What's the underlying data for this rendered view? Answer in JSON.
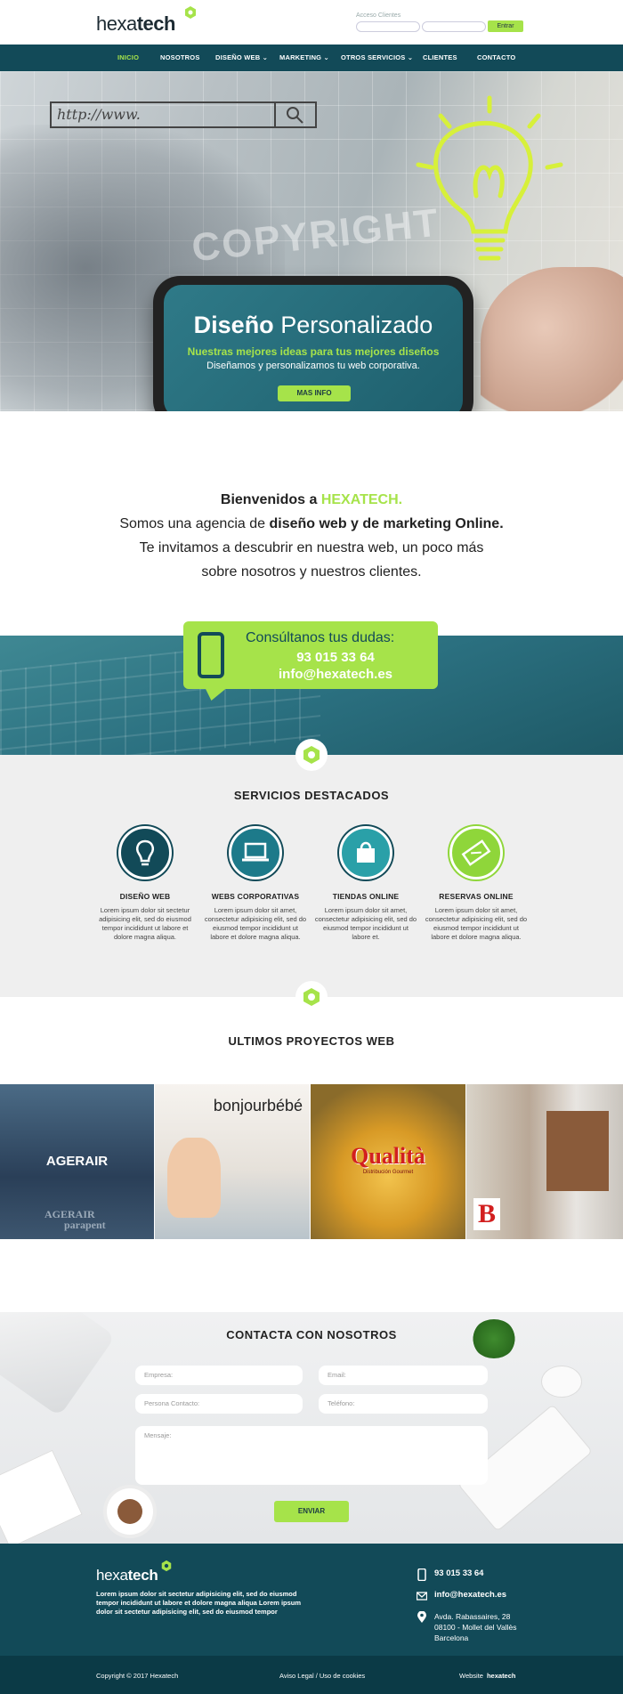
{
  "header": {
    "logo_light": "hexa",
    "logo_bold": "tech",
    "login_label": "Acceso Clientes",
    "login_button": "Entrar"
  },
  "nav": {
    "items": [
      "INICIO",
      "NOSOTROS",
      "DISEÑO WEB",
      "MARKETING",
      "OTROS SERVICIOS",
      "CLIENTES",
      "CONTACTO"
    ],
    "active": "INICIO"
  },
  "hero": {
    "url_text": "http://www.",
    "bg_text": "COPYRIGHT",
    "title_bold": "Diseño",
    "title_light": "Personalizado",
    "subtitle": "Nuestras mejores ideas para tus mejores diseños",
    "description": "Diseñamos y personalizamos tu web corporativa.",
    "button": "MAS INFO"
  },
  "welcome": {
    "line1_pre": "Bienvenidos a ",
    "line1_accent": "HEXATECH.",
    "line2_pre": "Somos una agencia de ",
    "line2_bold": "diseño web y de marketing Online.",
    "line3": "Te invitamos a descubrir en nuestra web, un poco más",
    "line4": "sobre nosotros y nuestros clientes."
  },
  "banner": {
    "title": "Consúltanos tus dudas:",
    "phone": "93 015 33 64",
    "email": "info@hexatech.es"
  },
  "services": {
    "title": "SERVICIOS DESTACADOS",
    "items": [
      {
        "name": "DISEÑO WEB",
        "icon": "lightbulb-icon",
        "color": "#124a58",
        "desc": "Lorem ipsum dolor sit sectetur adipisicing elit, sed do eiusmod tempor incididunt ut labore et dolore magna aliqua."
      },
      {
        "name": "WEBS CORPORATIVAS",
        "icon": "laptop-icon",
        "color": "#1d7a8a",
        "desc": "Lorem ipsum dolor sit amet, consectetur adipisicing elit, sed do eiusmod tempor incididunt ut labore et dolore magna aliqua."
      },
      {
        "name": "TIENDAS ONLINE",
        "icon": "shopping-bag-icon",
        "color": "#2aa0a8",
        "desc": "Lorem ipsum dolor sit amet, consectetur adipisicing elit, sed do eiusmod tempor incididunt ut labore et."
      },
      {
        "name": "RESERVAS ONLINE",
        "icon": "ticket-icon",
        "color": "#8fd63a",
        "desc": "Lorem ipsum dolor sit amet, consectetur adipisicing elit, sed do eiusmod tempor incididunt ut labore et dolore magna aliqua."
      }
    ]
  },
  "projects": {
    "title": "ULTIMOS PROYECTOS WEB",
    "items": [
      {
        "title": "AGERAIR",
        "brand_line1": "AGERAIR",
        "brand_line2": "parapent"
      },
      {
        "title": "bonjourbébé"
      },
      {
        "title": "Qualità",
        "subtitle": "Distribución Gourmet"
      },
      {
        "title": "B"
      }
    ]
  },
  "contact": {
    "title": "CONTACTA CON NOSOTROS",
    "placeholders": {
      "company": "Empresa:",
      "email": "Email:",
      "person": "Persona Contacto:",
      "phone": "Teléfono:",
      "message": "Mensaje:"
    },
    "button": "ENVIAR"
  },
  "footer": {
    "logo_light": "hexa",
    "logo_bold": "tech",
    "text": "Lorem ipsum dolor sit sectetur adipisicing elit, sed do eiusmod tempor incididunt ut labore et dolore magna aliqua Lorem ipsum dolor sit sectetur adipisicing elit, sed do eiusmod tempor",
    "phone": "93 015 33 64",
    "email": "info@hexatech.es",
    "address1": "Avda. Rabassaires, 28",
    "address2": "08100 - Mollet del Vallès",
    "address3": "Barcelona",
    "copyright": "Copyright © 2017 Hexatech",
    "legal": "Aviso Legal / Uso de cookies",
    "website_label": "Website",
    "website_brand": "hexatech"
  },
  "colors": {
    "primary": "#124a58",
    "accent": "#a6e34a"
  }
}
